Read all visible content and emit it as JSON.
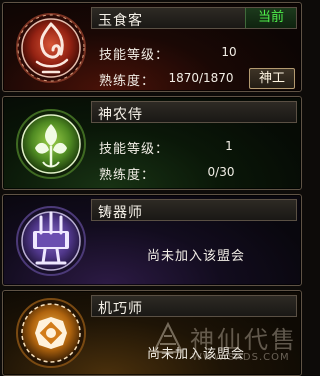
{
  "professions": [
    {
      "name": "玉食客",
      "badge": "当前",
      "skill_level_label": "技能等级：",
      "skill_level_value": "10",
      "proficiency_label": "熟练度：",
      "proficiency_value": "1870/1870",
      "rank_button": "神工",
      "emblem_icon": "flame-dragon-icon",
      "accent": "#c0301a"
    },
    {
      "name": "神农侍",
      "skill_level_label": "技能等级：",
      "skill_level_value": "1",
      "proficiency_label": "熟练度：",
      "proficiency_value": "0/30",
      "emblem_icon": "herb-leaf-icon",
      "accent": "#6fa832"
    },
    {
      "name": "铸器师",
      "notice": "尚未加入该盟会",
      "emblem_icon": "weapon-rack-icon",
      "accent": "#8c6ad2"
    },
    {
      "name": "机巧师",
      "notice": "尚未加入该盟会",
      "emblem_icon": "gear-mechanism-icon",
      "accent": "#e08a1c"
    }
  ],
  "watermark": {
    "text": "神仙代售",
    "url": "WWW.SXDS.COM"
  }
}
